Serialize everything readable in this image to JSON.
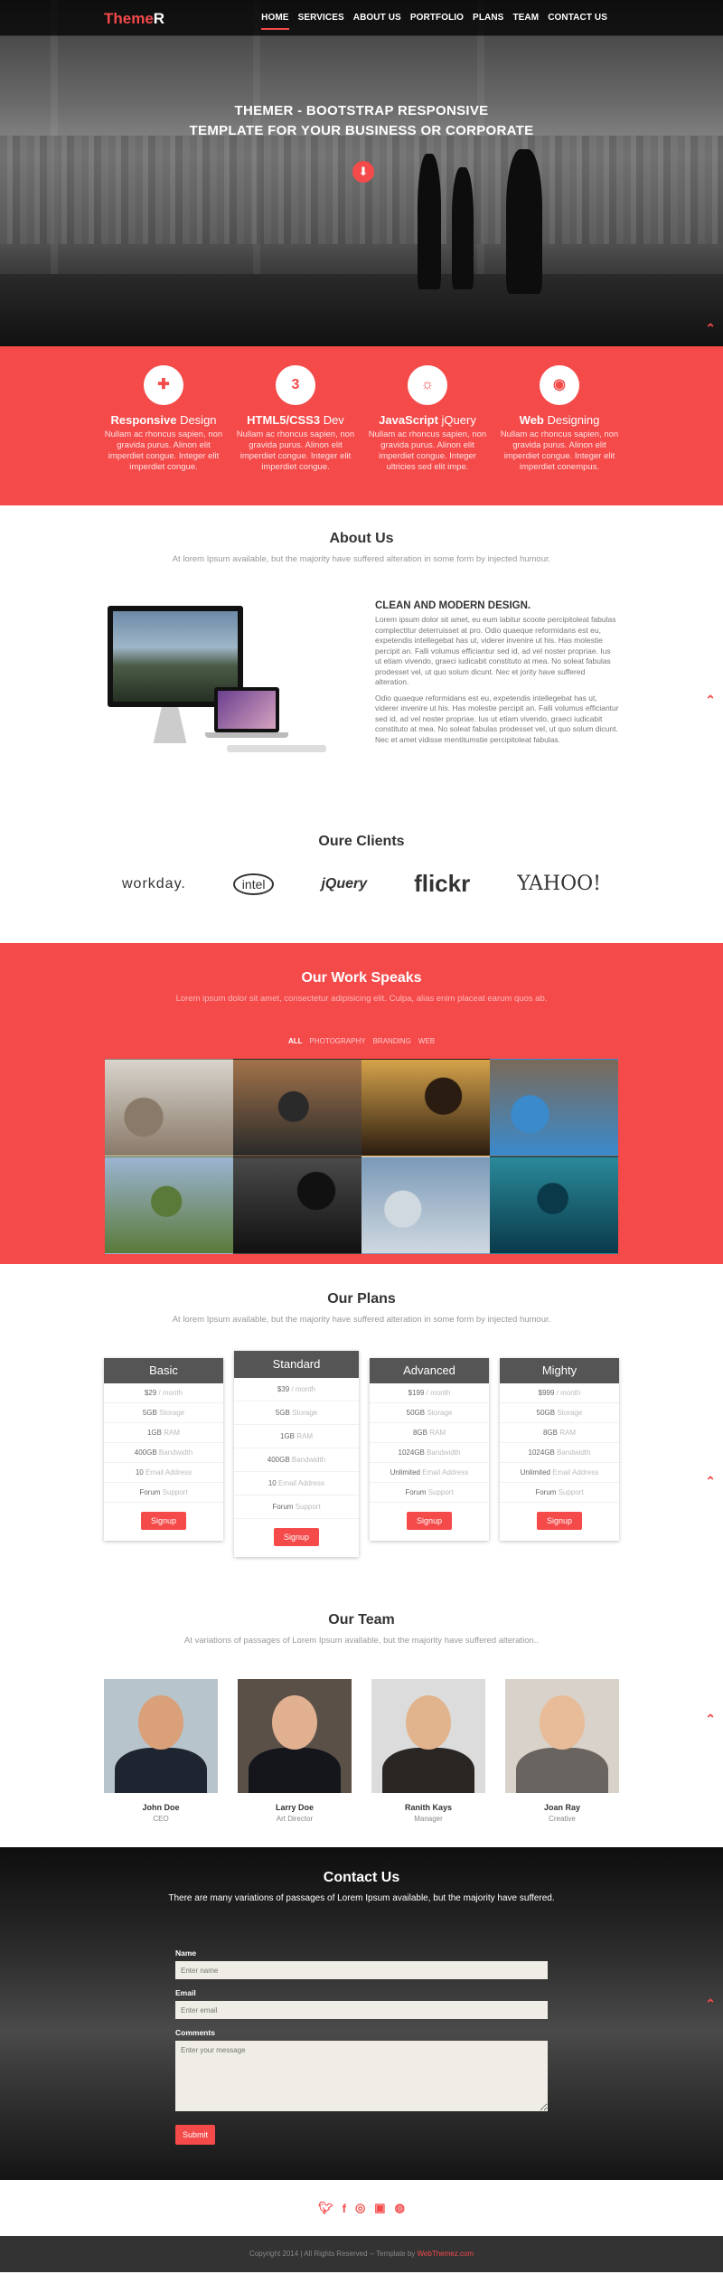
{
  "brand": {
    "logo_main": "Theme",
    "logo_end": "R"
  },
  "nav": [
    "HOME",
    "SERVICES",
    "ABOUT US",
    "PORTFOLIO",
    "PLANS",
    "TEAM",
    "CONTACT US"
  ],
  "hero": {
    "title_line1": "THEMER - BOOTSTRAP RESPONSIVE",
    "title_line2": "TEMPLATE FOR YOUR BUSINESS OR CORPORATE"
  },
  "features": [
    {
      "strong": "Responsive",
      "rest": " Design",
      "icon": "plus-icon",
      "text": "Nullam ac rhoncus sapien, non gravida purus. Alinon elit imperdiet congue. Integer elit imperdiet congue."
    },
    {
      "strong": "HTML5/CSS3",
      "rest": " Dev",
      "icon": "css3-icon",
      "text": "Nullam ac rhoncus sapien, non gravida purus. Alinon elit imperdiet congue. Integer elit imperdiet congue."
    },
    {
      "strong": "JavaScript",
      "rest": " jQuery",
      "icon": "lightbulb-icon",
      "text": "Nullam ac rhoncus sapien, non gravida purus. Alinon elit imperdiet congue. Integer ultricies sed elit impe."
    },
    {
      "strong": "Web",
      "rest": " Designing",
      "icon": "dribbble-icon",
      "text": "Nullam ac rhoncus sapien, non gravida purus. Alinon elit imperdiet congue. Integer elit imperdiet conempus."
    }
  ],
  "about": {
    "title": "About Us",
    "subtitle": "At lorem Ipsum available, but the majority have suffered alteration in some form by injected humour.",
    "heading": "CLEAN AND MODERN DESIGN.",
    "para1": "Lorem ipsum dolor sit amet, eu eum labitur scoote percipitoleat fabulas complectitur deterruisset at pro. Odio quaeque reformidans est eu, expetendis intellegebat has ut, viderer invenire ut his. Has molestie percipit an. Falli volumus efficiantur sed id, ad vel noster propriae. Ius ut etiam vivendo, graeci iudicabit constituto at mea. No soleat fabulas prodesset vel, ut quo solum dicunt. Nec et jority have suffered alteration.",
    "para2": "Odio quaeque reformidans est eu, expetendis intellegebat has ut, viderer invenire ut his. Has molestie percipit an. Falli volumus efficiantur sed id, ad vel noster propriae. Ius ut etiam vivendo, graeci iudicabit constituto at mea. No soleat fabulas prodesset vel, ut quo solum dicunt. Nec et amet vidisse mentitumstie percipitoleat fabulas."
  },
  "clients": {
    "title": "Oure Clients",
    "logos": [
      "workday.",
      "intel",
      "jQuery",
      "flickr",
      "YAHOO!"
    ]
  },
  "work": {
    "title": "Our Work Speaks",
    "subtitle": "Lorem ipsum dolor sit amet, consectetur adipisicing elit. Culpa, alias enim placeat earum quos ab.",
    "filters": [
      "ALL",
      "PHOTOGRAPHY",
      "BRANDING",
      "WEB"
    ],
    "tiles": [
      {
        "name": "mouse-photo",
        "bg": "#d8d4cc",
        "accent": "#8a7a6a"
      },
      {
        "name": "power-lines-photo",
        "bg": "#a2734a",
        "accent": "#2a2a2a"
      },
      {
        "name": "jumping-people-photo",
        "bg": "#d6a34a",
        "accent": "#2a1c10"
      },
      {
        "name": "laptop-chart-photo",
        "bg": "#7a6a5a",
        "accent": "#3a8acc"
      },
      {
        "name": "motocross-photo",
        "bg": "#9cb4d2",
        "accent": "#5a7a3a"
      },
      {
        "name": "surfer-photo",
        "bg": "#4a4a4a",
        "accent": "#111111"
      },
      {
        "name": "paraglider-photo",
        "bg": "#7a9ab8",
        "accent": "#d0d8e0"
      },
      {
        "name": "ocean-jump-photo",
        "bg": "#2a8a9a",
        "accent": "#0a3a4a"
      }
    ]
  },
  "plans": {
    "title": "Our Plans",
    "subtitle": "At lorem Ipsum available, but the majority have suffered alteration in some form by injected humour.",
    "items": [
      {
        "name": "Basic",
        "price": "$29",
        "per": " / month",
        "storage": "5GB",
        "storage_l": " Storage",
        "ram": "1GB",
        "ram_l": " RAM",
        "bw": "400GB",
        "bw_l": " Bandwidth",
        "email": "10",
        "email_l": " Email Address",
        "forum": "Forum",
        "forum_l": " Support",
        "cta": "Signup"
      },
      {
        "name": "Standard",
        "price": "$39",
        "per": " / month",
        "storage": "5GB",
        "storage_l": " Storage",
        "ram": "1GB",
        "ram_l": " RAM",
        "bw": "400GB",
        "bw_l": " Bandwidth",
        "email": "10",
        "email_l": " Email Address",
        "forum": "Forum",
        "forum_l": " Support",
        "cta": "Signup"
      },
      {
        "name": "Advanced",
        "price": "$199",
        "per": " / month",
        "storage": "50GB",
        "storage_l": " Storage",
        "ram": "8GB",
        "ram_l": " RAM",
        "bw": "1024GB",
        "bw_l": " Bandwidth",
        "email": "Unlimited",
        "email_l": " Email Address",
        "forum": "Forum",
        "forum_l": " Support",
        "cta": "Signup"
      },
      {
        "name": "Mighty",
        "price": "$999",
        "per": " / month",
        "storage": "50GB",
        "storage_l": " Storage",
        "ram": "8GB",
        "ram_l": " RAM",
        "bw": "1024GB",
        "bw_l": " Bandwidth",
        "email": "Unlimited",
        "email_l": " Email Address",
        "forum": "Forum",
        "forum_l": " Support",
        "cta": "Signup"
      }
    ]
  },
  "team": {
    "title": "Our Team",
    "subtitle": "At variations of passages of Lorem Ipsum available, but the majority have suffered alteration..",
    "members": [
      {
        "name": "John Doe",
        "role": "CEO",
        "bg": "#b8c4cc",
        "skin": "#d9a07a",
        "suit": "#1e2430"
      },
      {
        "name": "Larry Doe",
        "role": "Art Director",
        "bg": "#5a5048",
        "skin": "#e0b090",
        "suit": "#14161c"
      },
      {
        "name": "Ranith Kays",
        "role": "Manager",
        "bg": "#dcdcdc",
        "skin": "#e2b48e",
        "suit": "#2a2624"
      },
      {
        "name": "Joan Ray",
        "role": "Creative",
        "bg": "#d8d2ca",
        "skin": "#e8bc98",
        "suit": "#6a6460"
      }
    ]
  },
  "contact": {
    "title": "Contact Us",
    "subtitle": "There are many variations of passages of Lorem Ipsum available, but the majority have suffered.",
    "name_label": "Name",
    "name_ph": "Enter name",
    "email_label": "Email",
    "email_ph": "Enter email",
    "comments_label": "Comments",
    "comments_ph": "Enter your message",
    "submit": "Submit"
  },
  "social": [
    "twitter-icon",
    "facebook-icon",
    "dribbble-icon",
    "flickr-icon",
    "github-icon"
  ],
  "footer": {
    "text": "Copyright 2014 | All Rights Reserved -- Template by ",
    "link": "WebThemez.com"
  },
  "colors": {
    "accent": "#f44a4a"
  }
}
